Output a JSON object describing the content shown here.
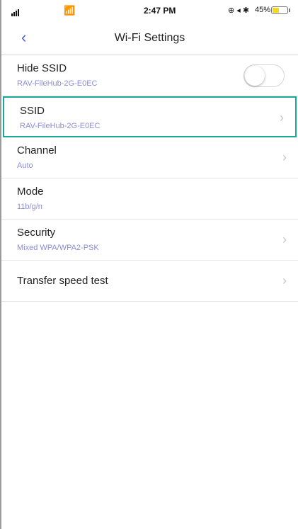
{
  "status_bar": {
    "time": "2:47 PM",
    "battery_percent_text": "45%",
    "battery_level": 0.45,
    "battery_color": "#f5d91c"
  },
  "nav": {
    "back_icon": "chevron-left-icon",
    "title": "Wi-Fi Settings"
  },
  "rows": [
    {
      "label": "Hide SSID",
      "value": "RAV-FileHub-2G-E0EC",
      "control": "toggle",
      "toggle_on": false
    },
    {
      "label": "SSID",
      "value": "RAV-FileHub-2G-E0EC",
      "control": "chevron"
    },
    {
      "label": "Channel",
      "value": "Auto",
      "control": "chevron"
    },
    {
      "label": "Mode",
      "value": "11b/g/n",
      "control": "none"
    },
    {
      "label": "Security",
      "value": "Mixed WPA/WPA2-PSK",
      "control": "chevron"
    },
    {
      "label": "Transfer speed test",
      "value": "",
      "control": "chevron"
    }
  ],
  "colors": {
    "accent": "#4b5bd6",
    "value_text": "#8a8cd8",
    "highlight_border": "#1aa89a"
  }
}
